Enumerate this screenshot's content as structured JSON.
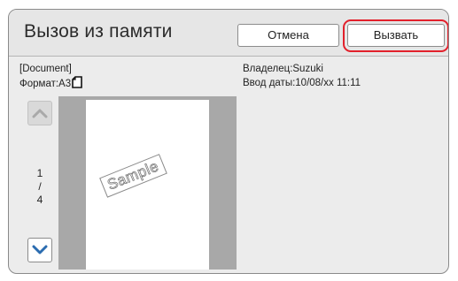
{
  "header": {
    "title": "Вызов из памяти",
    "cancel_label": "Отмена",
    "recall_label": "Вызвать"
  },
  "document": {
    "name": "[Document]",
    "format_label": "Формат:A3",
    "owner": "Владелец:Suzuki",
    "date": "Ввод даты:10/08/xx 11:11"
  },
  "pager": {
    "current": "1",
    "separator": "/",
    "total": "4"
  },
  "preview": {
    "watermark": "Sample"
  },
  "colors": {
    "highlight": "#e2202b",
    "nav_arrow": "#2b6cb0"
  },
  "icons": {
    "paper": "portrait-paper-icon",
    "up": "chevron-up-icon",
    "down": "chevron-down-icon"
  }
}
